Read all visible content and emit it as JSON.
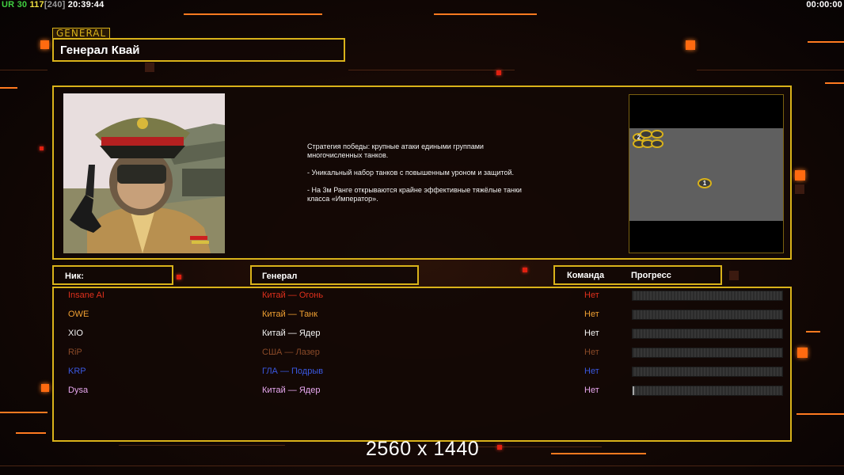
{
  "hud": {
    "prefix": "UR",
    "fps": "30",
    "value": "117",
    "bracket_value": "[240]",
    "clock": "20:39:44",
    "timer": "00:00:00"
  },
  "general_tag": "GENERAL",
  "general_name": "Генерал Квай",
  "description": [
    "Стратегия победы: крупные атаки едиными группами\n многочисленных танков.",
    "- Уникальный набор танков с повышенным уроном и защитой.",
    "- На 3м Ранге открываются крайне эффективные тяжёлые танки\n класса «Император»."
  ],
  "map": {
    "player_spots": [
      "2",
      "",
      "",
      "",
      "",
      "",
      "1"
    ]
  },
  "headers": {
    "nick": "Ник:",
    "general": "Генерал",
    "team": "Команда",
    "progress": "Прогресс"
  },
  "players": [
    {
      "nick": "Insane AI",
      "general": "Китай — Огонь",
      "team": "Нет",
      "color": "#e0301c",
      "general_color": "#e0301c",
      "progress": 0
    },
    {
      "nick": "OWE",
      "general": "Китай — Танк",
      "team": "Нет",
      "color": "#f0a032",
      "general_color": "#f0a032",
      "progress": 0
    },
    {
      "nick": "XIO",
      "general": "Китай — Ядер",
      "team": "Нет",
      "color": "#f4f4f4",
      "general_color": "#f4f4f4",
      "progress": 0
    },
    {
      "nick": "RiP",
      "general": "США — Лазер",
      "team": "Нет",
      "color": "#8a4a28",
      "general_color": "#8a4a28",
      "progress": 0
    },
    {
      "nick": "KRP",
      "general": "ГЛА — Подрыв",
      "team": "Нет",
      "color": "#3a58e0",
      "general_color": "#3a58e0",
      "progress": 0
    },
    {
      "nick": "Dysa",
      "general": "Китай — Ядер",
      "team": "Нет",
      "color": "#e8a8f0",
      "general_color": "#e8a8f0",
      "progress": 0.01
    }
  ],
  "resolution_label": "2560 x 1440",
  "colors": {
    "frame": "#d9b21a",
    "accent": "#ff6a10",
    "background": "#0c0605"
  }
}
